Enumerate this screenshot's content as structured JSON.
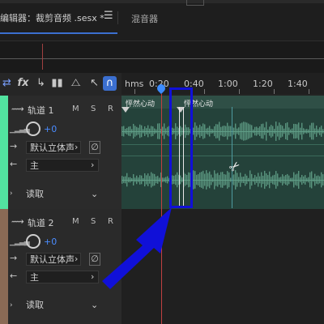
{
  "tabs": {
    "editor_label": "编辑器：裁剪音频 .sesx *",
    "menu_glyph": "☰",
    "mixer_label": "混音器"
  },
  "toolbar": {
    "loop_glyph": "⇄",
    "fx_glyph": "fx",
    "input_glyph": "↳",
    "bars_glyph": "▮▮",
    "metronome_glyph": "⧍",
    "arrow_glyph": "↖",
    "snap_glyph": "∩"
  },
  "ruler": {
    "unit": "hms",
    "ticks": [
      "0:20",
      "0:40",
      "1:00",
      "1:20",
      "1:40"
    ]
  },
  "tracks": [
    {
      "name": "轨道 1",
      "mute": "M",
      "solo": "S",
      "record": "R",
      "volume": "+0",
      "output": "默认立体声",
      "input": "主",
      "automation": "读取",
      "color": "#52e3a0"
    },
    {
      "name": "轨道 2",
      "mute": "M",
      "solo": "S",
      "record": "R",
      "volume": "+0",
      "output": "默认立体声",
      "input": "主",
      "automation": "读取",
      "color": "#8a6a55"
    }
  ],
  "clips": [
    {
      "label": "怦然心动"
    },
    {
      "label": "怦然心动"
    }
  ],
  "colors": {
    "accent": "#3b6fd0",
    "volume_text": "#4a8cff",
    "annotation_blue": "#1010d8",
    "waveform": "#5f9d86"
  }
}
